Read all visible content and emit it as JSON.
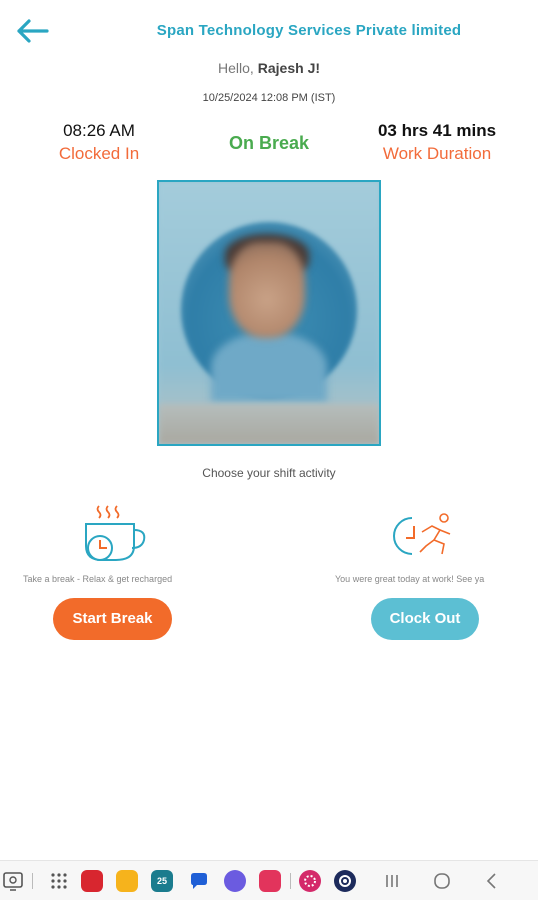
{
  "header": {
    "company": "Span Technology Services Private limited"
  },
  "greeting": {
    "prefix": "Hello,",
    "name": "Rajesh J!"
  },
  "datetime": "10/25/2024 12:08 PM (IST)",
  "clock_in": {
    "time": "08:26 AM",
    "label": "Clocked In"
  },
  "status": "On Break",
  "work_duration": {
    "value": "03 hrs 41 mins",
    "label": "Work Duration"
  },
  "activity_prompt": "Choose your shift activity",
  "break_action": {
    "caption": "Take a break - Relax & get recharged",
    "button": "Start Break"
  },
  "clockout_action": {
    "caption": "You were great today at work! See ya",
    "button": "Clock Out"
  },
  "colors": {
    "accent_teal": "#2aa6c2",
    "orange": "#f26b2a",
    "green": "#4aab4f",
    "clockout_blue": "#5cbfd3"
  },
  "navbar": {
    "icons": [
      "screen-recorder-icon",
      "app-drawer-icon",
      "app-red-icon",
      "app-folder-icon",
      "calendar-icon",
      "chat-icon",
      "app-purple-icon",
      "app-pink-icon",
      "app-flower-icon",
      "settings-icon",
      "recents-icon",
      "home-icon",
      "back-nav-icon"
    ],
    "calendar_day": "25"
  }
}
